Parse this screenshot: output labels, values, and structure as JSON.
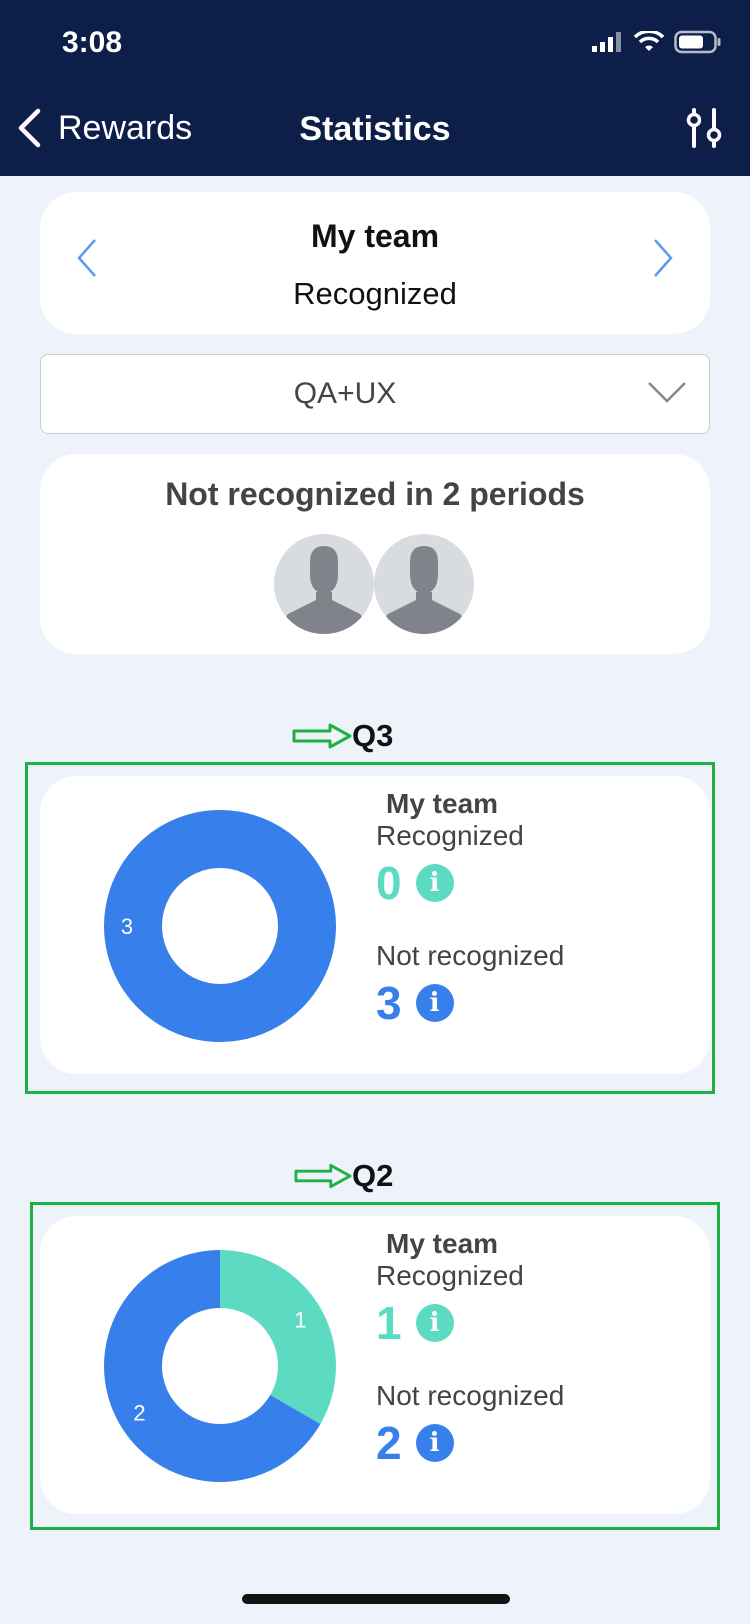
{
  "status_bar": {
    "time": "3:08"
  },
  "nav": {
    "back_label": "Rewards",
    "title": "Statistics"
  },
  "team_selector": {
    "title": "My team",
    "subtitle": "Recognized"
  },
  "group_select": {
    "value": "QA+UX"
  },
  "not_recognized_card": {
    "title": "Not recognized in 2 periods",
    "avatar_count": 2
  },
  "colors": {
    "header": "#0d1f48",
    "recognized": "#5ddbc2",
    "not_recognized": "#377fea",
    "highlight": "#1fb045"
  },
  "periods": [
    {
      "label": "Q3",
      "team": "My team",
      "recognized_label": "Recognized",
      "recognized_value": "0",
      "not_recognized_label": "Not recognized",
      "not_recognized_value": "3"
    },
    {
      "label": "Q2",
      "team": "My team",
      "recognized_label": "Recognized",
      "recognized_value": "1",
      "not_recognized_label": "Not recognized",
      "not_recognized_value": "2"
    }
  ],
  "chart_data": [
    {
      "type": "pie",
      "categories": [
        "Recognized",
        "Not recognized"
      ],
      "values": [
        0,
        3
      ],
      "data_labels": [
        "3"
      ]
    },
    {
      "type": "pie",
      "categories": [
        "Recognized",
        "Not recognized"
      ],
      "values": [
        1,
        2
      ],
      "data_labels": [
        "1",
        "2"
      ]
    }
  ]
}
